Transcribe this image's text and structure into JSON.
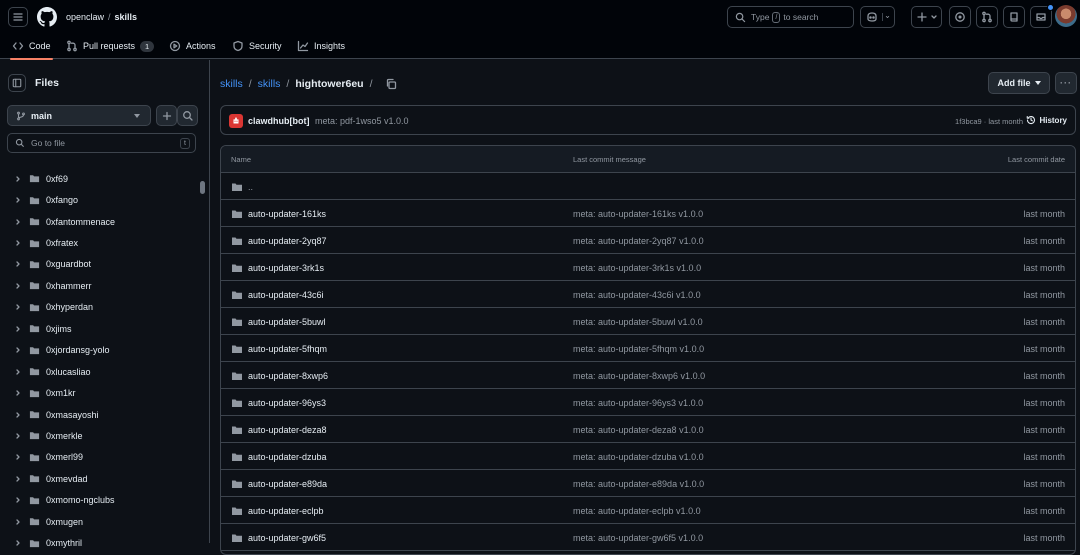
{
  "header": {
    "org": "openclaw",
    "repo": "skills",
    "search": {
      "prefix": "Type",
      "key": "/",
      "suffix": "to search"
    }
  },
  "nav": {
    "tabs": [
      {
        "label": "Code",
        "icon": "code-icon"
      },
      {
        "label": "Pull requests",
        "icon": "pull-request-icon",
        "count": "1"
      },
      {
        "label": "Actions",
        "icon": "play-icon"
      },
      {
        "label": "Security",
        "icon": "shield-icon"
      },
      {
        "label": "Insights",
        "icon": "graph-icon"
      }
    ]
  },
  "sidebar": {
    "title": "Files",
    "branch": "main",
    "goto_placeholder": "Go to file",
    "goto_key": "t",
    "items": [
      "0xf69",
      "0xfango",
      "0xfantommenace",
      "0xfratex",
      "0xguardbot",
      "0xhammerr",
      "0xhyperdan",
      "0xjims",
      "0xjordansg-yolo",
      "0xlucasliao",
      "0xm1kr",
      "0xmasayoshi",
      "0xmerkle",
      "0xmerl99",
      "0xmevdad",
      "0xmomo-ngclubs",
      "0xmugen",
      "0xmythril"
    ]
  },
  "breadcrumb": {
    "root": "skills",
    "dir": "skills",
    "current": "hightower6eu"
  },
  "toolbar": {
    "add_file": "Add file",
    "more": "···"
  },
  "commit": {
    "author": "clawdhub[bot]",
    "message": "meta: pdf-1wso5 v1.0.0",
    "sha_time": "1f3bca9 · last month",
    "history": "History"
  },
  "table": {
    "headers": {
      "name": "Name",
      "message": "Last commit message",
      "date": "Last commit date"
    },
    "parent": "..",
    "rows": [
      {
        "name": "auto-updater-161ks",
        "message": "meta: auto-updater-161ks v1.0.0",
        "date": "last month"
      },
      {
        "name": "auto-updater-2yq87",
        "message": "meta: auto-updater-2yq87 v1.0.0",
        "date": "last month"
      },
      {
        "name": "auto-updater-3rk1s",
        "message": "meta: auto-updater-3rk1s v1.0.0",
        "date": "last month"
      },
      {
        "name": "auto-updater-43c6i",
        "message": "meta: auto-updater-43c6i v1.0.0",
        "date": "last month"
      },
      {
        "name": "auto-updater-5buwl",
        "message": "meta: auto-updater-5buwl v1.0.0",
        "date": "last month"
      },
      {
        "name": "auto-updater-5fhqm",
        "message": "meta: auto-updater-5fhqm v1.0.0",
        "date": "last month"
      },
      {
        "name": "auto-updater-8xwp6",
        "message": "meta: auto-updater-8xwp6 v1.0.0",
        "date": "last month"
      },
      {
        "name": "auto-updater-96ys3",
        "message": "meta: auto-updater-96ys3 v1.0.0",
        "date": "last month"
      },
      {
        "name": "auto-updater-deza8",
        "message": "meta: auto-updater-deza8 v1.0.0",
        "date": "last month"
      },
      {
        "name": "auto-updater-dzuba",
        "message": "meta: auto-updater-dzuba v1.0.0",
        "date": "last month"
      },
      {
        "name": "auto-updater-e89da",
        "message": "meta: auto-updater-e89da v1.0.0",
        "date": "last month"
      },
      {
        "name": "auto-updater-eclpb",
        "message": "meta: auto-updater-eclpb v1.0.0",
        "date": "last month"
      },
      {
        "name": "auto-updater-gw6f5",
        "message": "meta: auto-updater-gw6f5 v1.0.0",
        "date": "last month"
      }
    ]
  },
  "colors": {
    "link": "#4493f8",
    "accent": "#f78166",
    "bg": "#0d1117",
    "border": "#3d444d"
  }
}
